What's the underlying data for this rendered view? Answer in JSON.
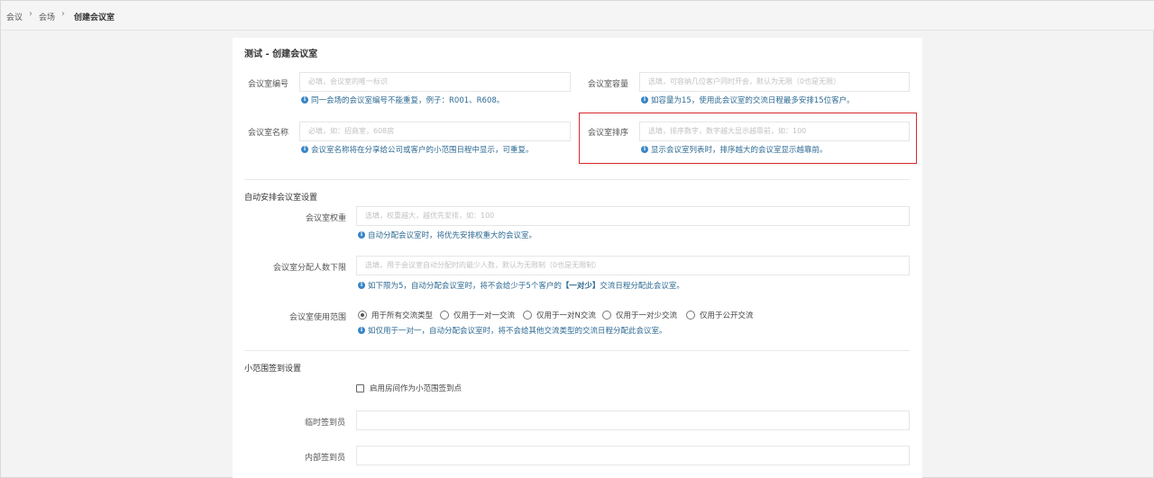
{
  "breadcrumb": [
    "会议",
    "会场",
    "创建会议室"
  ],
  "page_title": "测试 - 创建会议室",
  "fields": {
    "room_number": {
      "label": "会议室编号",
      "placeholder": "必填，会议室的唯一标识",
      "help": "同一会场的会议室编号不能重复，例子：R001、R608。"
    },
    "capacity": {
      "label": "会议室容量",
      "placeholder": "选填，可容纳几位客户同时开会，默认为无限（0也是无限）",
      "help": "如容量为15，使用此会议室的交流日程最多安排15位客户。"
    },
    "room_name": {
      "label": "会议室名称",
      "placeholder": "必填，如：招商室，608房",
      "help": "会议室名称将在分享给公司或客户的小范围日程中显示，可重复。"
    },
    "sort_order": {
      "label": "会议室排序",
      "placeholder": "选填，排序数字，数字越大显示越靠前，如：100",
      "help": "显示会议室列表时，排序越大的会议室显示越靠前。"
    }
  },
  "auto_section": {
    "title": "自动安排会议室设置",
    "weight": {
      "label": "会议室权重",
      "placeholder": "选填，权重越大，越优先安排，如：100",
      "help": "自动分配会议室时，将优先安排权重大的会议室。"
    },
    "min_people": {
      "label": "会议室分配人数下限",
      "placeholder": "选填，用于会议室自动分配时的最少人数，默认为无限制（0也是无限制）",
      "help_pre": "如下限为5，自动分配会议室时，将不会给少于5个客户的",
      "help_bold": "【一对少】",
      "help_post": "交流日程分配此会议室。"
    },
    "scope": {
      "label": "会议室使用范围",
      "options": [
        "用于所有交流类型",
        "仅用于一对一交流",
        "仅用于一对N交流",
        "仅用于一对少交流",
        "仅用于公开交流"
      ],
      "selected": "用于所有交流类型",
      "help": "如仅用于一对一，自动分配会议室时，将不会给其他交流类型的交流日程分配此会议室。"
    }
  },
  "checkin_section": {
    "title": "小范围签到设置",
    "enable_label": "启用房间作为小范围签到点",
    "enabled": false,
    "temp_checker_label": "临时签到员",
    "internal_checker_label": "内部签到员"
  },
  "colors": {
    "accent_help": "#2d6a93",
    "info_icon": "#3a85c6",
    "highlight_border": "#d9272e"
  }
}
